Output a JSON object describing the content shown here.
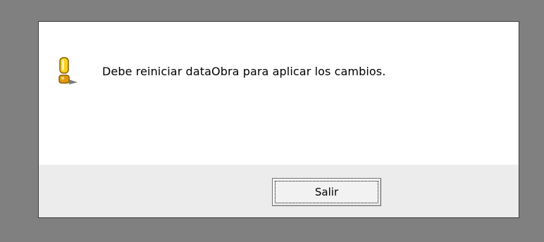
{
  "dialog": {
    "message": "Debe reiniciar dataObra para aplicar los cambios.",
    "icon": "warning-icon",
    "buttons": {
      "salir_label": "Salir"
    }
  },
  "colors": {
    "backdrop": "#808080",
    "dialog_background": "#ffffff",
    "button_bar": "#ececec",
    "icon_yellow": "#f5c518",
    "icon_orange": "#d48a00"
  }
}
